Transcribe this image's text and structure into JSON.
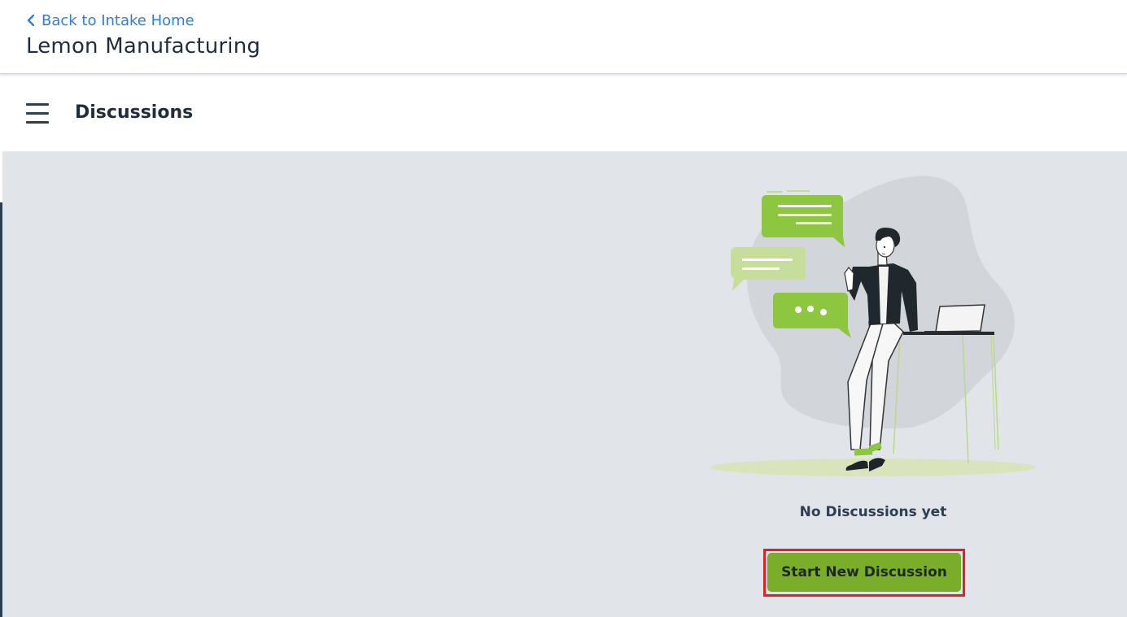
{
  "header": {
    "back_label": "Back to Intake Home",
    "title": "Lemon Manufacturing"
  },
  "subheader": {
    "title": "Discussions"
  },
  "empty_state": {
    "message": "No Discussions yet",
    "button_label": "Start New Discussion"
  },
  "colors": {
    "link": "#2f7fd4",
    "accent_green": "#7aad29",
    "bubble_green": "#8dc63f",
    "content_bg": "#e1e4e8",
    "highlight_border": "#e0202a"
  },
  "icons": {
    "back": "chevron-left-icon",
    "menu": "hamburger-menu-icon"
  }
}
